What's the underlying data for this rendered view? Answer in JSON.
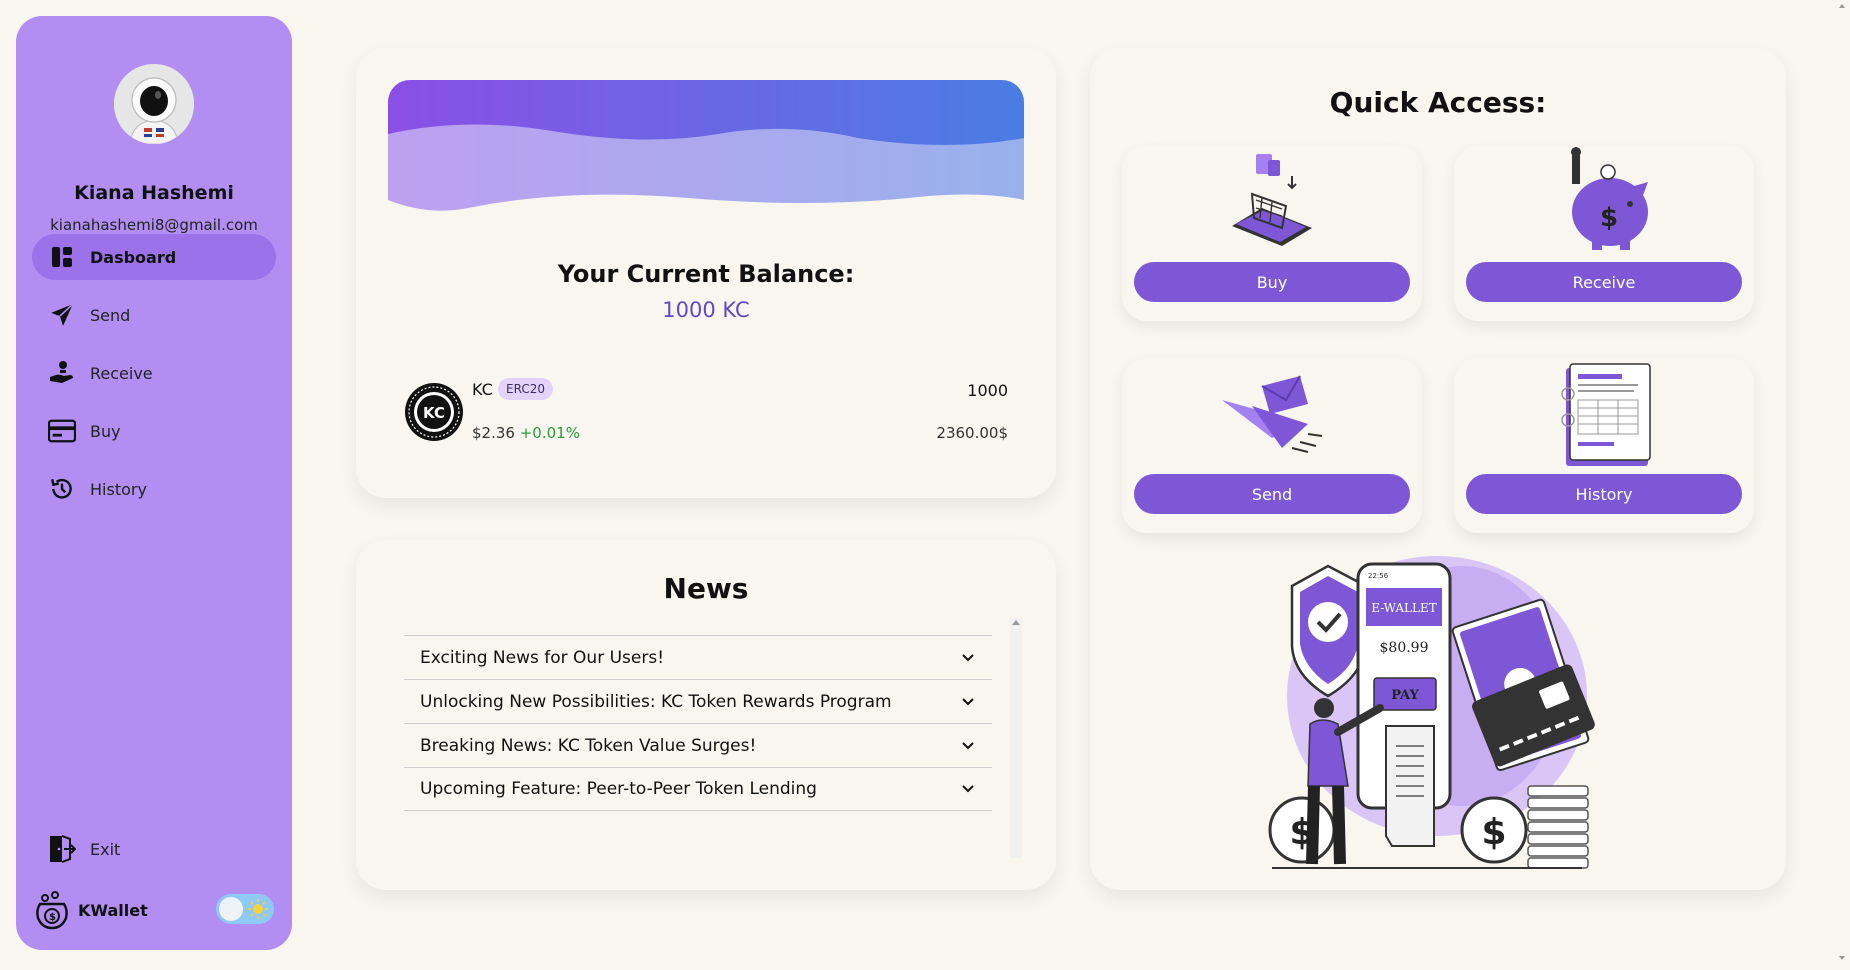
{
  "sidebar": {
    "user_name": "Kiana Hashemi",
    "user_email": "kianahashemi8@gmail.com",
    "items": [
      {
        "label": "Dasboard",
        "icon": "dashboard-icon",
        "active": true
      },
      {
        "label": "Send",
        "icon": "paper-plane-icon"
      },
      {
        "label": "Receive",
        "icon": "hand-coin-icon"
      },
      {
        "label": "Buy",
        "icon": "card-icon"
      },
      {
        "label": "History",
        "icon": "history-icon"
      }
    ],
    "exit_label": "Exit",
    "brand": "KWallet",
    "theme_toggle": "light",
    "accent": "#b38ef2",
    "active_bg": "#9c72eb"
  },
  "balance": {
    "title": "Your Current Balance:",
    "value": "1000 KC",
    "token": {
      "logo_text": "KC",
      "symbol": "KC",
      "badge": "ERC20",
      "price": "$2.36",
      "change": "+0.01%",
      "amount": "1000",
      "usd_value": "2360.00$"
    }
  },
  "news": {
    "title": "News",
    "items": [
      "Exciting News for Our Users!",
      "Unlocking New Possibilities: KC Token Rewards Program",
      "Breaking News: KC Token Value Surges!",
      "Upcoming Feature: Peer-to-Peer Token Lending"
    ]
  },
  "quick_access": {
    "title": "Quick Access:",
    "tiles": [
      {
        "label": "Buy",
        "icon": "shopping-cart-illustration"
      },
      {
        "label": "Receive",
        "icon": "piggy-bank-illustration"
      },
      {
        "label": "Send",
        "icon": "paper-plane-envelope-illustration"
      },
      {
        "label": "History",
        "icon": "document-illustration"
      }
    ],
    "illustration": {
      "header": "E-WALLET",
      "amount": "$80.99",
      "pay_label": "PAY",
      "phone_time": "22:56"
    },
    "button_color": "#7d57d6"
  }
}
